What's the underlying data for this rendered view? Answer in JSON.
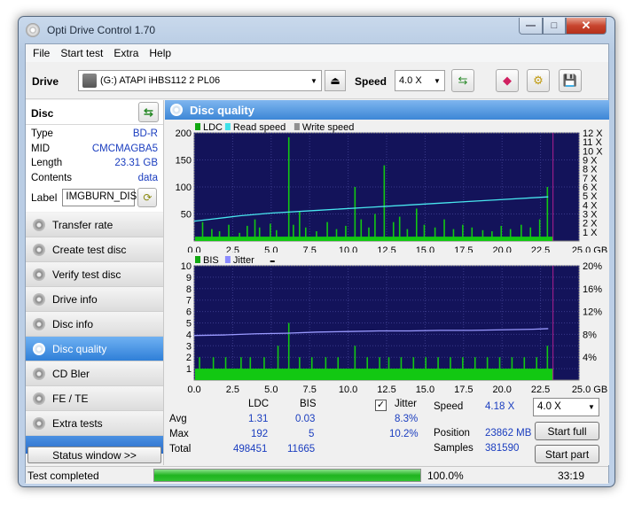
{
  "window": {
    "title": "Opti Drive Control 1.70"
  },
  "menu": [
    "File",
    "Start test",
    "Extra",
    "Help"
  ],
  "toolbar": {
    "drive_label": "Drive",
    "drive_value": "(G:)   ATAPI iHBS112   2 PL06",
    "speed_label": "Speed",
    "speed_value": "4.0 X"
  },
  "disc": {
    "header": "Disc",
    "rows": [
      {
        "key": "Type",
        "value": "BD-R"
      },
      {
        "key": "MID",
        "value": "CMCMAGBA5"
      },
      {
        "key": "Length",
        "value": "23.31 GB"
      },
      {
        "key": "Contents",
        "value": "data"
      }
    ],
    "label_key": "Label",
    "label_value": "IMGBURN_DIS"
  },
  "nav": [
    "Transfer rate",
    "Create test disc",
    "Verify test disc",
    "Drive info",
    "Disc info",
    "Disc quality",
    "CD Bler",
    "FE / TE",
    "Extra tests"
  ],
  "nav_active": 5,
  "status_window_label": "Status window >>",
  "main_title": "Disc quality",
  "chart_data": [
    {
      "type": "bar",
      "legend": [
        {
          "name": "LDC",
          "color": "#12a812"
        },
        {
          "name": "Read speed",
          "color": "#3ee0e8"
        },
        {
          "name": "Write speed",
          "color": "#909090"
        }
      ],
      "x_ticks": [
        "0.0",
        "2.5",
        "5.0",
        "7.5",
        "10.0",
        "12.5",
        "15.0",
        "17.5",
        "20.0",
        "22.5",
        "25.0 GB"
      ],
      "y_left_ticks": [
        "200",
        "150",
        "100",
        "50"
      ],
      "y_right_ticks": [
        "12 X",
        "11 X",
        "10 X",
        "9 X",
        "8 X",
        "7 X",
        "6 X",
        "5 X",
        "4 X",
        "3 X",
        "2 X",
        "1 X"
      ],
      "xlim": [
        0,
        25
      ],
      "ylim": [
        0,
        200
      ],
      "y2lim": [
        0,
        12
      ],
      "ldc_spikes": [
        [
          0.5,
          35
        ],
        [
          1.1,
          22
        ],
        [
          1.6,
          18
        ],
        [
          2.2,
          30
        ],
        [
          2.9,
          15
        ],
        [
          3.4,
          28
        ],
        [
          3.9,
          40
        ],
        [
          4.2,
          25
        ],
        [
          4.9,
          32
        ],
        [
          5.3,
          20
        ],
        [
          6.1,
          192
        ],
        [
          6.4,
          30
        ],
        [
          6.8,
          55
        ],
        [
          7.2,
          25
        ],
        [
          7.9,
          18
        ],
        [
          8.6,
          35
        ],
        [
          9.2,
          22
        ],
        [
          9.8,
          28
        ],
        [
          10.4,
          100
        ],
        [
          10.8,
          40
        ],
        [
          11.3,
          25
        ],
        [
          11.7,
          50
        ],
        [
          12.3,
          140
        ],
        [
          12.9,
          35
        ],
        [
          13.3,
          45
        ],
        [
          13.8,
          22
        ],
        [
          14.4,
          60
        ],
        [
          14.9,
          30
        ],
        [
          15.6,
          25
        ],
        [
          16.2,
          40
        ],
        [
          16.8,
          22
        ],
        [
          17.4,
          30
        ],
        [
          18.0,
          25
        ],
        [
          18.7,
          20
        ],
        [
          19.3,
          18
        ],
        [
          19.9,
          28
        ],
        [
          20.5,
          22
        ],
        [
          21.2,
          30
        ],
        [
          21.8,
          25
        ],
        [
          22.4,
          40
        ],
        [
          22.9,
          100
        ]
      ],
      "ldc_base": 8,
      "read_speed": [
        [
          0,
          2.2
        ],
        [
          1,
          2.4
        ],
        [
          3,
          2.8
        ],
        [
          5,
          3.1
        ],
        [
          8,
          3.4
        ],
        [
          11,
          3.7
        ],
        [
          14,
          4.0
        ],
        [
          17,
          4.3
        ],
        [
          20,
          4.6
        ],
        [
          23,
          4.9
        ]
      ]
    },
    {
      "type": "bar",
      "legend": [
        {
          "name": "BIS",
          "color": "#12a812"
        },
        {
          "name": "Jitter",
          "color": "#8a8aff"
        }
      ],
      "x_ticks": [
        "0.0",
        "2.5",
        "5.0",
        "7.5",
        "10.0",
        "12.5",
        "15.0",
        "17.5",
        "20.0",
        "22.5",
        "25.0 GB"
      ],
      "y_left_ticks": [
        "10",
        "9",
        "8",
        "7",
        "6",
        "5",
        "4",
        "3",
        "2",
        "1"
      ],
      "y_right_ticks": [
        "20%",
        "16%",
        "12%",
        "8%",
        "4%"
      ],
      "xlim": [
        0,
        25
      ],
      "ylim": [
        0,
        10
      ],
      "y2lim": [
        0,
        20
      ],
      "bis_base": 1,
      "bis_spikes": [
        [
          0.3,
          2
        ],
        [
          1.2,
          2
        ],
        [
          2.0,
          2
        ],
        [
          3.0,
          2
        ],
        [
          3.6,
          2
        ],
        [
          4.5,
          2
        ],
        [
          5.4,
          3
        ],
        [
          6.1,
          5
        ],
        [
          6.8,
          2
        ],
        [
          7.6,
          2
        ],
        [
          8.5,
          2
        ],
        [
          9.3,
          2
        ],
        [
          10.4,
          3
        ],
        [
          11.2,
          2
        ],
        [
          12.0,
          2
        ],
        [
          12.6,
          2
        ],
        [
          13.4,
          2
        ],
        [
          14.2,
          2
        ],
        [
          15.0,
          2
        ],
        [
          15.8,
          2
        ],
        [
          16.6,
          2
        ],
        [
          17.4,
          2
        ],
        [
          18.2,
          2
        ],
        [
          19.0,
          2
        ],
        [
          19.8,
          2
        ],
        [
          20.6,
          2
        ],
        [
          21.4,
          2
        ],
        [
          22.2,
          2
        ],
        [
          22.9,
          3
        ]
      ],
      "jitter": [
        [
          0,
          7.8
        ],
        [
          2,
          7.9
        ],
        [
          4,
          8.1
        ],
        [
          6,
          8.2
        ],
        [
          8,
          8.4
        ],
        [
          10,
          8.5
        ],
        [
          12,
          8.6
        ],
        [
          14,
          8.6
        ],
        [
          16,
          8.7
        ],
        [
          18,
          8.7
        ],
        [
          20,
          8.8
        ],
        [
          22,
          8.9
        ],
        [
          23,
          9.0
        ]
      ]
    }
  ],
  "stats": {
    "col_ldc": "LDC",
    "col_bis": "BIS",
    "jitter_label": "Jitter",
    "jitter_checked": "✓",
    "avg_label": "Avg",
    "max_label": "Max",
    "total_label": "Total",
    "avg_ldc": "1.31",
    "avg_bis": "0.03",
    "avg_jitter": "8.3%",
    "max_ldc": "192",
    "max_bis": "5",
    "max_jitter": "10.2%",
    "total_ldc": "498451",
    "total_bis": "11665",
    "speed_label": "Speed",
    "speed_value": "4.18 X",
    "position_label": "Position",
    "position_value": "23862 MB",
    "samples_label": "Samples",
    "samples_value": "381590",
    "speed_select": "4.0 X",
    "start_full": "Start full",
    "start_part": "Start part"
  },
  "status": {
    "text": "Test completed",
    "progress": 1.0,
    "progress_text": "100.0%",
    "time": "33:19"
  }
}
